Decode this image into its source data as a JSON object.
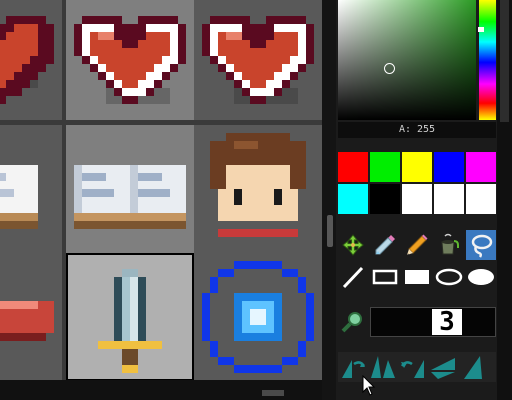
{
  "color_picker": {
    "alpha_label": "A: 255",
    "current_color": "#2a9a23"
  },
  "palette": {
    "swatches": [
      "#ff0000",
      "#00ee00",
      "#ffff00",
      "#0000ff",
      "#ff00ff",
      "#00ffff",
      "#000000",
      "#ffffff",
      "#ffffff",
      "#ffffff"
    ]
  },
  "tools": {
    "row1": [
      "move-icon",
      "eyedropper-icon",
      "pencil-icon",
      "bucket-icon",
      "lasso-icon"
    ],
    "row2": [
      "line-icon",
      "rectangle-outline-icon",
      "rectangle-filled-icon",
      "ellipse-outline-icon",
      "ellipse-filled-icon"
    ],
    "active_tool": "lasso-icon"
  },
  "brush": {
    "size": "3"
  },
  "tiles": [
    "heart",
    "heart",
    "heart",
    "scroll",
    "scroll",
    "character-face",
    "meat",
    "sword",
    "blue-gem"
  ]
}
